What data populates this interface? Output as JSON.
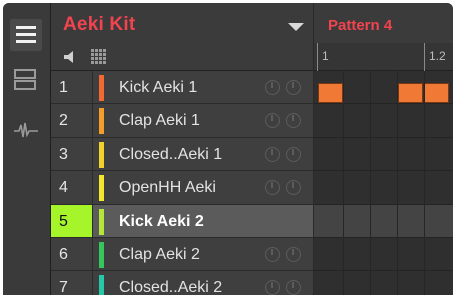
{
  "group": {
    "title": "Aeki Kit"
  },
  "pattern": {
    "title": "Pattern 4",
    "bar_labels": [
      "1",
      "1.2"
    ]
  },
  "sounds": [
    {
      "number": "1",
      "name": "Kick Aeki 1",
      "color": "#f26a32"
    },
    {
      "number": "2",
      "name": "Clap Aeki 1",
      "color": "#f59d2a"
    },
    {
      "number": "3",
      "name": "Closed..Aeki 1",
      "color": "#f0d32a"
    },
    {
      "number": "4",
      "name": "OpenHH Aeki",
      "color": "#f5e62e"
    },
    {
      "number": "5",
      "name": "Kick Aeki 2",
      "color": "#b7e63a"
    },
    {
      "number": "6",
      "name": "Clap Aeki 2",
      "color": "#33c75e"
    },
    {
      "number": "7",
      "name": "Closed..Aeki 2",
      "color": "#25c9a7"
    }
  ],
  "selected_index": 4,
  "selected_pad_color": "#a6f52b",
  "accent_color": "#f2434e",
  "note_color": "#f07a35",
  "icons": [
    "menu-icon",
    "mixer-icon",
    "waveform-icon",
    "speaker-icon",
    "grid-icon",
    "chevron-down-icon",
    "knob-icon"
  ]
}
